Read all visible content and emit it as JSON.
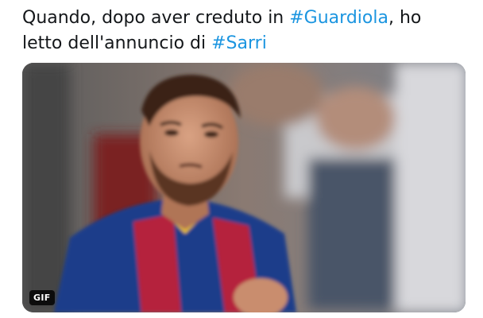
{
  "tweet": {
    "text_line1_before": "Quando, dopo aver creduto in ",
    "hashtag_1": "#Guardiola",
    "text_line1_after": ", ho",
    "text_line2_before": "letto dell'annuncio di ",
    "hashtag_2": "#Sarri",
    "hashtag_color": "#1b95e0"
  },
  "media": {
    "type": "gif",
    "badge_label": "GIF"
  }
}
